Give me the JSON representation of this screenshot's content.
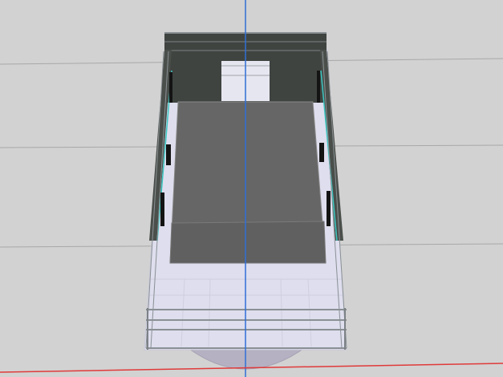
{
  "viewport": {
    "background": "#d2d2d2",
    "grid_line_color": "#a6a6a6",
    "y_axis_color": "#2f6fd6",
    "x_axis_color": "#e03a3a"
  },
  "model": {
    "description_icon": "boat-hull-3d",
    "deck_color": "#dcdcec",
    "cabin_roof_color": "#666666",
    "back_wall_color": "#3f4440",
    "rail_color": "#8a9094",
    "window_color": "#111111",
    "accent_trim_color": "#3cc7c2",
    "hull_bottom_color": "#b8b4c4"
  }
}
